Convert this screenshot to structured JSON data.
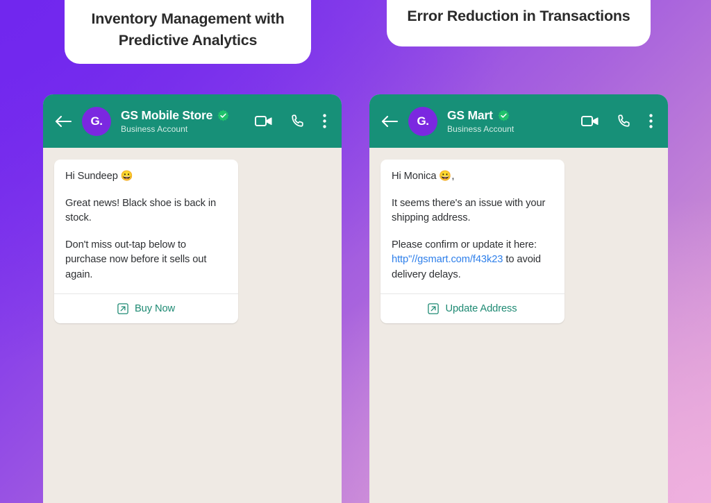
{
  "background": {
    "gradient_from": "#7127EE",
    "gradient_to": "#E6A8D8"
  },
  "title_cards": [
    {
      "text": "Inventory Management with Predictive Analytics"
    },
    {
      "text": "Error Reduction in Transactions"
    }
  ],
  "phones": [
    {
      "header": {
        "back_icon": "arrow-left-icon",
        "avatar_initials": "G.",
        "avatar_color": "#7B28E0",
        "name": "GS Mobile Store",
        "verified": true,
        "subtitle": "Business Account",
        "video_icon": "video-camera-icon",
        "call_icon": "phone-icon",
        "menu_icon": "more-vertical-icon",
        "background_color": "#179078"
      },
      "message": {
        "greeting": "Hi Sundeep ",
        "greeting_emoji": "😀",
        "paragraphs": [
          "Great news! Black shoe is back in stock.",
          "Don't miss out-tap below to purchase now before it sells out again."
        ],
        "action_label": "Buy Now",
        "action_icon": "external-link-icon",
        "action_color": "#1E8A73"
      }
    },
    {
      "header": {
        "back_icon": "arrow-left-icon",
        "avatar_initials": "G.",
        "avatar_color": "#7B28E0",
        "name": "GS Mart",
        "verified": true,
        "subtitle": "Business Account",
        "video_icon": "video-camera-icon",
        "call_icon": "phone-icon",
        "menu_icon": "more-vertical-icon",
        "background_color": "#179078"
      },
      "message": {
        "greeting": "Hi Monica ",
        "greeting_emoji": "😀",
        "greeting_suffix": ",",
        "paragraphs": [
          "It seems there's an issue with your shipping address."
        ],
        "link_intro": "Please confirm or update it here: ",
        "link_text": "http\"//gsmart.com/f43k23",
        "link_suffix": " to avoid delivery delays.",
        "link_color": "#2E7FEA",
        "action_label": "Update Address",
        "action_icon": "external-link-icon",
        "action_color": "#1E8A73"
      }
    }
  ]
}
